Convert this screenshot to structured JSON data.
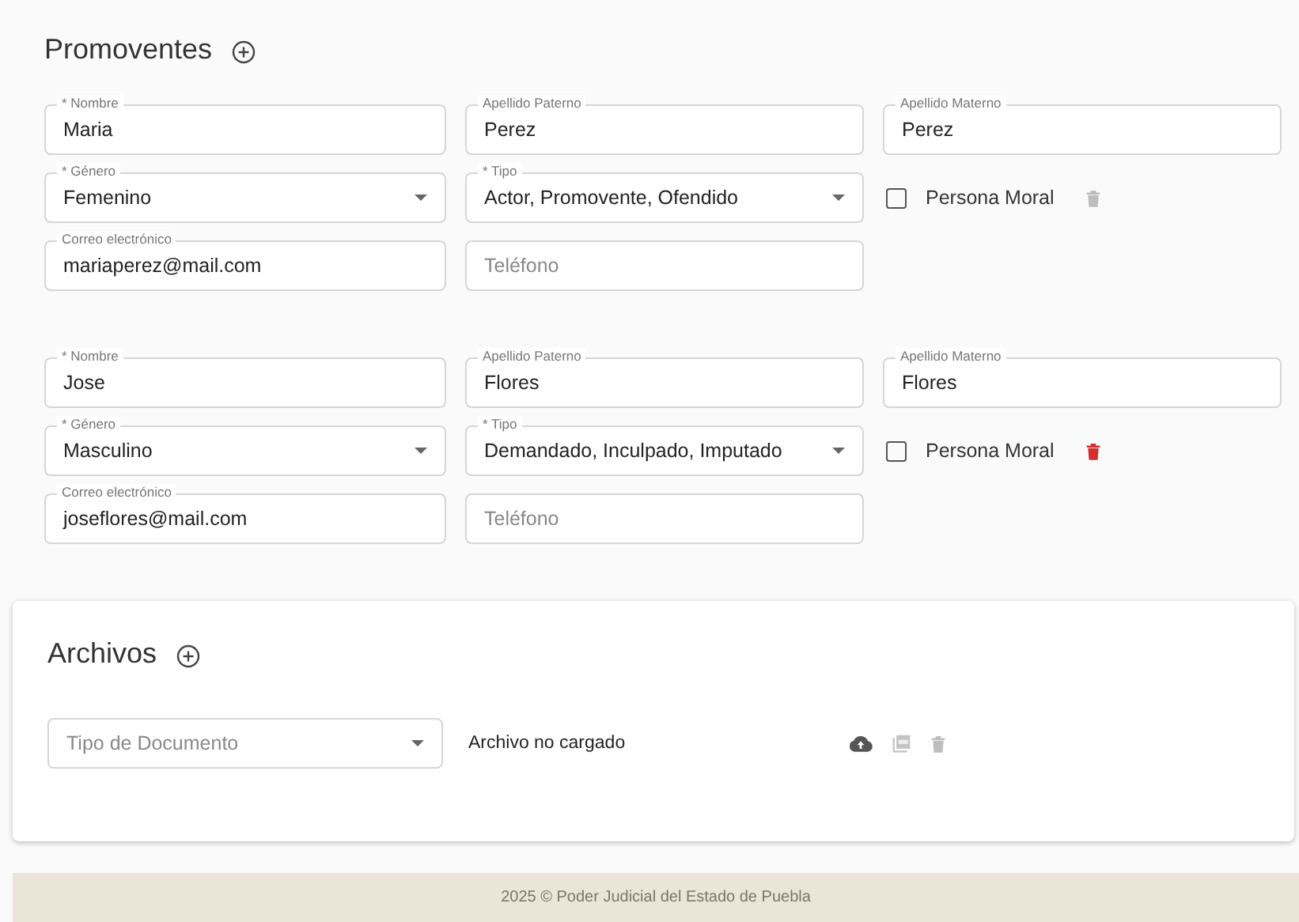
{
  "promoventes": {
    "title": "Promoventes",
    "people": [
      {
        "nombre": {
          "label": "* Nombre",
          "value": "Maria"
        },
        "paterno": {
          "label": "Apellido Paterno",
          "value": "Perez"
        },
        "materno": {
          "label": "Apellido Materno",
          "value": "Perez"
        },
        "genero": {
          "label": "* Género",
          "value": "Femenino"
        },
        "tipo": {
          "label": "* Tipo",
          "value": "Actor, Promovente, Ofendido"
        },
        "persona_moral": {
          "label": "Persona Moral",
          "checked": false
        },
        "delete_disabled": true,
        "correo": {
          "label": "Correo electrónico",
          "value": "mariaperez@mail.com"
        },
        "telefono": {
          "placeholder": "Teléfono"
        }
      },
      {
        "nombre": {
          "label": "* Nombre",
          "value": "Jose"
        },
        "paterno": {
          "label": "Apellido Paterno",
          "value": "Flores"
        },
        "materno": {
          "label": "Apellido Materno",
          "value": "Flores"
        },
        "genero": {
          "label": "* Género",
          "value": "Masculino"
        },
        "tipo": {
          "label": "* Tipo",
          "value": "Demandado, Inculpado, Imputado"
        },
        "persona_moral": {
          "label": "Persona Moral",
          "checked": false
        },
        "delete_disabled": false,
        "correo": {
          "label": "Correo electrónico",
          "value": "joseflores@mail.com"
        },
        "telefono": {
          "placeholder": "Teléfono"
        }
      }
    ]
  },
  "archivos": {
    "title": "Archivos",
    "rows": [
      {
        "tipo": {
          "placeholder": "Tipo de Documento"
        },
        "status": "Archivo no cargado",
        "delete_disabled": true
      }
    ]
  },
  "footer": "2025 © Poder Judicial del Estado de Puebla"
}
